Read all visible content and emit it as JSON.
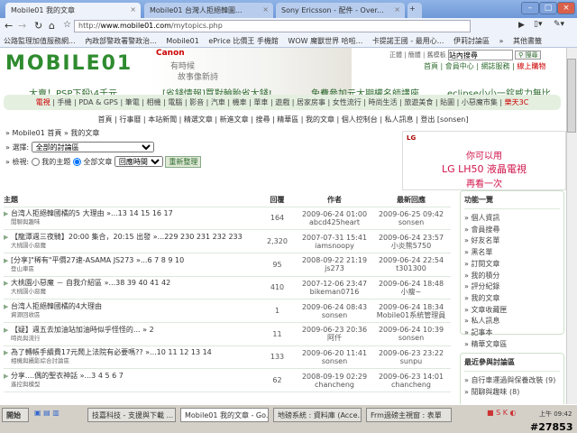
{
  "browser": {
    "tabs": [
      {
        "label": "Mobile01 我的文章"
      },
      {
        "label": "Mobile01 台灣人拒絕韓圖..."
      },
      {
        "label": "Sony Ericsson - 配件 - Over..."
      }
    ],
    "url_prefix": "http://",
    "url_host": "www.mobile01.com",
    "url_path": "/mytopics.php",
    "bookmarks": [
      "公路監理加值服務網...",
      "內政部警政署警政治...",
      "Mobile01",
      "ePrice 比價王 手機館",
      "WOW 魔獸世界 哈啦...",
      "卡提諾王國 - 最用心...",
      "伊莉討論區",
      "»",
      "其他書籤"
    ]
  },
  "header": {
    "logo": "MOBILE01",
    "banner_brand": "Canon",
    "banner_line1": "有時候",
    "banner_line2": "故事像新詩",
    "search_links": "正體 | 簡體 | 舊模板",
    "search_value": "站內搜尋",
    "search_button": "搜尋",
    "topnav": [
      "首頁",
      "會員中心",
      "網誌服務",
      "線上購物"
    ]
  },
  "promos": [
    "大賣！PSP下殺\\4千元",
    "[省錢情報]買對輪胎省大錢!",
    "免費參加元大期權名師講座",
    "eclipse小小一錠威力無比"
  ],
  "categories": [
    "電視",
    "手機",
    "PDA & GPS",
    "筆電",
    "相機",
    "電腦",
    "影音",
    "汽車",
    "機車",
    "單車",
    "遊戲",
    "居家房事",
    "女性流行",
    "時尚生活",
    "旅遊美食",
    "貼圖",
    "小惡魔市集",
    "樂天3C"
  ],
  "subnav": [
    "首頁",
    "行事曆",
    "本站新聞",
    "精選文章",
    "新進文章",
    "搜尋",
    "精華區",
    "我的文章",
    "個人控制台",
    "私人訊息",
    "登出 [sonsen]"
  ],
  "breadcrumb": "» Mobile01 首頁 » 我的文章",
  "select_label": "» 選擇:",
  "select_value": "全部的討論區",
  "view_label": "» 檢視:",
  "radio_mine": "我的主題",
  "radio_all": "全部文章",
  "sort_value": "回應時間",
  "refresh_button": "重新整理",
  "ad": {
    "brand": "LG",
    "line1": "你可以用",
    "line2": "LG LH50 液晶電視",
    "line3": "再看一次"
  },
  "table": {
    "headers": [
      "主題",
      "回覆",
      "作者",
      "最新回應"
    ],
    "rows": [
      {
        "title": "台湾人拒絕韓國橘的5 大理由",
        "pages": "»...13 14 15 16 17",
        "forum": "閒聊與趣味",
        "replies": "164",
        "date": "2009-06-24 01:00",
        "author": "abcd425heart",
        "last_date": "2009-06-25 09:42",
        "last_user": "sonsen"
      },
      {
        "title": "【龍潭週三夜騎】20:00 集合，20:15 出發",
        "pages": "»...229 230 231 232 233",
        "forum": "大桃園小惡魔",
        "replies": "2,320",
        "date": "2007-07-31 15:41",
        "author": "iamsnoopy",
        "last_date": "2009-06-24 23:57",
        "last_user": "小炎熊5750"
      },
      {
        "title": "[分享]\"稀有\"平價27速-ASAMA JS273",
        "pages": "»...6 7 8 9 10",
        "forum": "登山車區",
        "replies": "95",
        "date": "2008-09-22 21:19",
        "author": "js273",
        "last_date": "2009-06-24 22:54",
        "last_user": "t301300"
      },
      {
        "title": "大桃園小惡魔 － 自我介紹區",
        "pages": "»...38 39 40 41 42",
        "forum": "大桃園小惡魔",
        "replies": "410",
        "date": "2007-12-06 23:47",
        "author": "bikeman0716",
        "last_date": "2009-06-24 18:48",
        "last_user": "小瘦~"
      },
      {
        "title": "台湾人拒絕韓國橘的4大理由",
        "pages": "",
        "forum": "資源回收區",
        "replies": "1",
        "date": "2009-06-24 08:43",
        "author": "sonsen",
        "last_date": "2009-06-24 18:34",
        "last_user": "Mobile01系統管理員"
      },
      {
        "title": "【疑】週五去加油站加油時似乎怪怪的...",
        "pages": "» 2",
        "forum": "時尚與流行",
        "replies": "11",
        "date": "2009-06-23 20:36",
        "author": "阿仟",
        "last_date": "2009-06-24 10:39",
        "last_user": "sonsen"
      },
      {
        "title": "為了轉帳手續費17元鬧上法院有必要嗎??",
        "pages": "»...10 11 12 13 14",
        "forum": "相機與攝影綜合討論區",
        "replies": "133",
        "date": "2009-06-20 11:41",
        "author": "sonsen",
        "last_date": "2009-06-23 23:22",
        "last_user": "sunpu"
      },
      {
        "title": "分享....偶的聖衣神話",
        "pages": "»...3 4 5 6 7",
        "forum": "遙控與模型",
        "replies": "62",
        "date": "2008-09-19 02:29",
        "author": "chancheng",
        "last_date": "2009-06-23 14:01",
        "last_user": "chancheng"
      }
    ]
  },
  "sidebar": {
    "func_title": "功能一覽",
    "func_items": [
      "個人資訊",
      "會員搜尋",
      "好友名單",
      "黑名單",
      "訂閱文章",
      "我的積分",
      "評分紀錄",
      "我的文章",
      "文章收藏匣",
      "私人訊息",
      "記事本",
      "精華文章區"
    ],
    "recent_title": "最近參與討論區",
    "recent_items": [
      "自行車運過與保養改裝 (9)",
      "閒聊與趣味 (8)"
    ]
  },
  "taskbar": {
    "start": "開始",
    "tasks": [
      "技嘉科技 - 支援與下載 ...",
      "Mobile01 我的文章 - Go...",
      "地磅系統 : 資料庫 (Acce...",
      "Frm過磅主視窗 : 表單"
    ],
    "clock": "上午 09:42",
    "tag": "#27853"
  }
}
